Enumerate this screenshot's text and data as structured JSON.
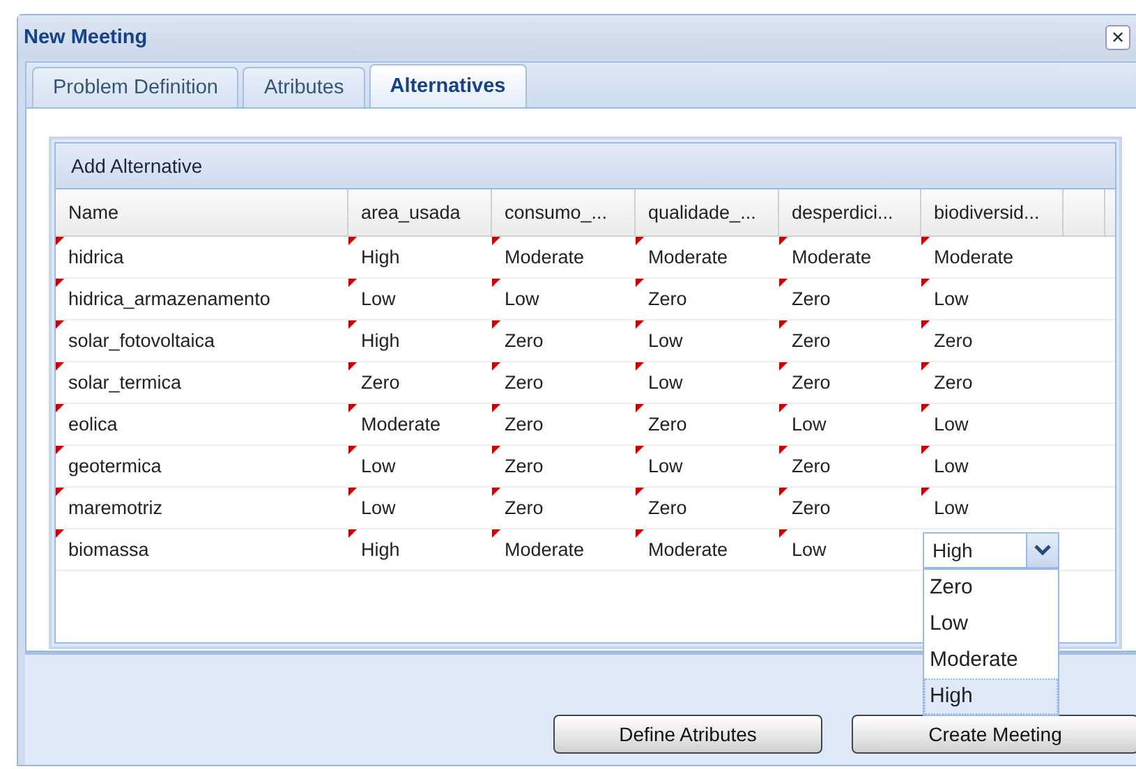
{
  "window": {
    "title": "New Meeting",
    "close": "✕"
  },
  "tabs": [
    {
      "label": "Problem Definition",
      "selected": false
    },
    {
      "label": "Atributes",
      "selected": false
    },
    {
      "label": "Alternatives",
      "selected": true
    }
  ],
  "grid": {
    "title": "Add Alternative",
    "columns": [
      "Name",
      "area_usada",
      "consumo_...",
      "qualidade_...",
      "desperdici...",
      "biodiversid..."
    ],
    "rows": [
      {
        "name": "hidrica",
        "dirty": true,
        "values": [
          "High",
          "Moderate",
          "Moderate",
          "Moderate",
          "Moderate"
        ]
      },
      {
        "name": "hidrica_armazenamento",
        "dirty": true,
        "values": [
          "Low",
          "Low",
          "Zero",
          "Zero",
          "Low"
        ]
      },
      {
        "name": "solar_fotovoltaica",
        "dirty": true,
        "values": [
          "High",
          "Zero",
          "Low",
          "Zero",
          "Zero"
        ]
      },
      {
        "name": "solar_termica",
        "dirty": true,
        "values": [
          "Zero",
          "Zero",
          "Low",
          "Zero",
          "Zero"
        ]
      },
      {
        "name": "eolica",
        "dirty": true,
        "values": [
          "Moderate",
          "Zero",
          "Zero",
          "Low",
          "Low"
        ]
      },
      {
        "name": "geotermica",
        "dirty": true,
        "values": [
          "Low",
          "Zero",
          "Low",
          "Zero",
          "Low"
        ]
      },
      {
        "name": "maremotriz",
        "dirty": true,
        "values": [
          "Low",
          "Zero",
          "Zero",
          "Zero",
          "Low"
        ]
      },
      {
        "name": "biomassa",
        "dirty": true,
        "values": [
          "High",
          "Moderate",
          "Moderate",
          "Low"
        ],
        "editor": {
          "value": "High",
          "options": [
            {
              "label": "Zero",
              "selected": false
            },
            {
              "label": "Low",
              "selected": false
            },
            {
              "label": "Moderate",
              "selected": false
            },
            {
              "label": "High",
              "selected": true
            }
          ]
        }
      }
    ]
  },
  "buttons": [
    "Define Atributes",
    "Create Meeting"
  ]
}
